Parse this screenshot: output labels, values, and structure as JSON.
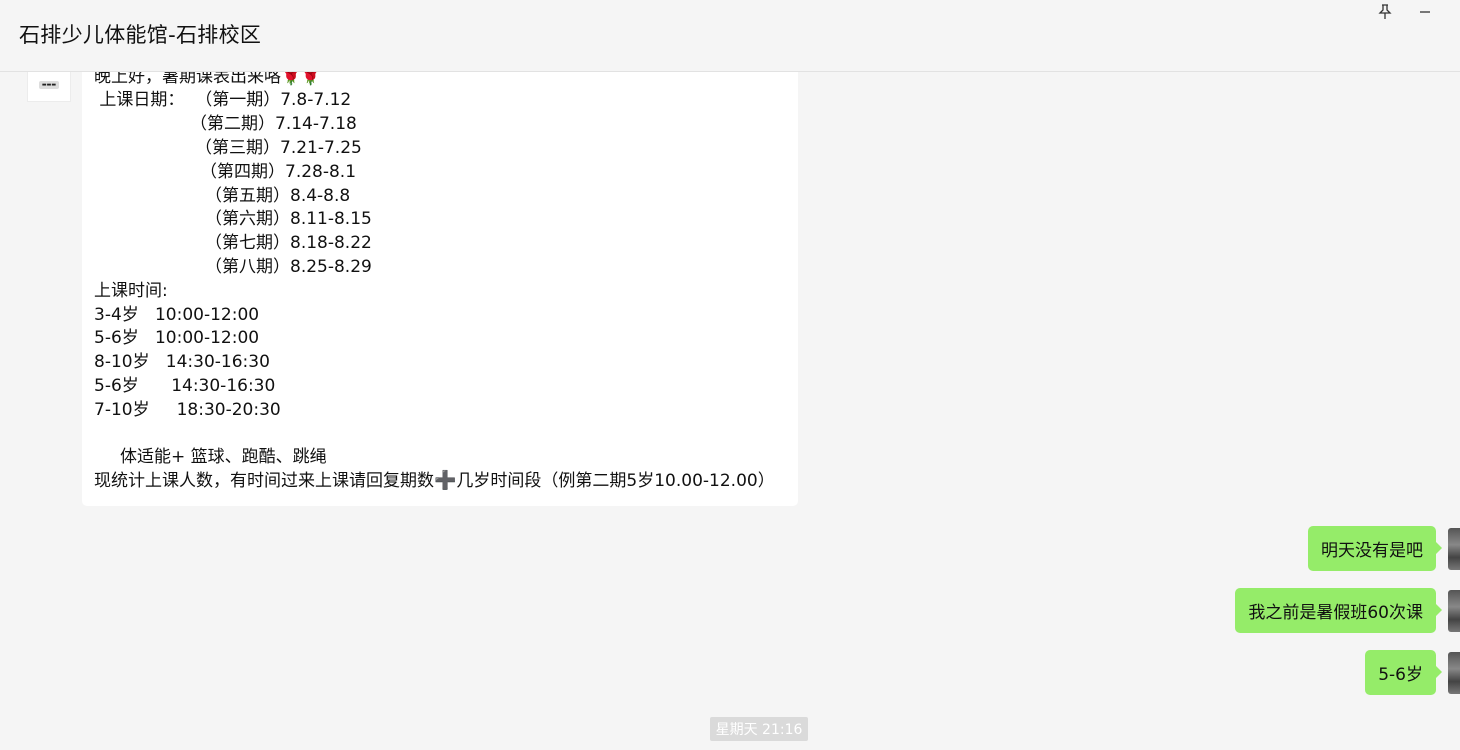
{
  "window": {
    "title": "石排少儿体能馆-石排校区",
    "pin_icon": "pin-icon",
    "minimize_icon": "minimize-icon"
  },
  "incoming_message": {
    "line_greeting": "晚上好，暑期课表出来咯",
    "line_greeting_emoji": "🌹🌹",
    "line_date_header": " 上课日期：  （第一期）7.8-7.12",
    "line_p2": "（第二期）7.14-7.18",
    "line_p3": "（第三期）7.21-7.25",
    "line_p4": "（第四期）7.28-8.1",
    "line_p5": "（第五期）8.4-8.8",
    "line_p6": "（第六期）8.11-8.15",
    "line_p7": "（第七期）8.18-8.22",
    "line_p8": "（第八期）8.25-8.29",
    "line_time_header": "上课时间:",
    "line_t1": "3-4岁   10:00-12:00",
    "line_t2": "5-6岁   10:00-12:00",
    "line_t3": "8-10岁   14:30-16:30",
    "line_t4": "5-6岁      14:30-16:30",
    "line_t5": "7-10岁     18:30-20:30",
    "line_courses": "体适能+ 篮球、跑酷、跳绳",
    "line_reply_a": "现统计上课人数，有时间过来上课请回复期数",
    "line_reply_cross": "➕",
    "line_reply_b": "几岁时间段（例第二期5岁10.00-12.00）"
  },
  "outgoing_messages": [
    {
      "text": "明天没有是吧"
    },
    {
      "text": "我之前是暑假班60次课"
    },
    {
      "text": "5-6岁"
    }
  ],
  "timestamp": "星期天 21:16",
  "colors": {
    "background": "#f5f5f5",
    "incoming_bubble": "#ffffff",
    "outgoing_bubble": "#95ec69",
    "timestamp_bg": "#dadada"
  }
}
